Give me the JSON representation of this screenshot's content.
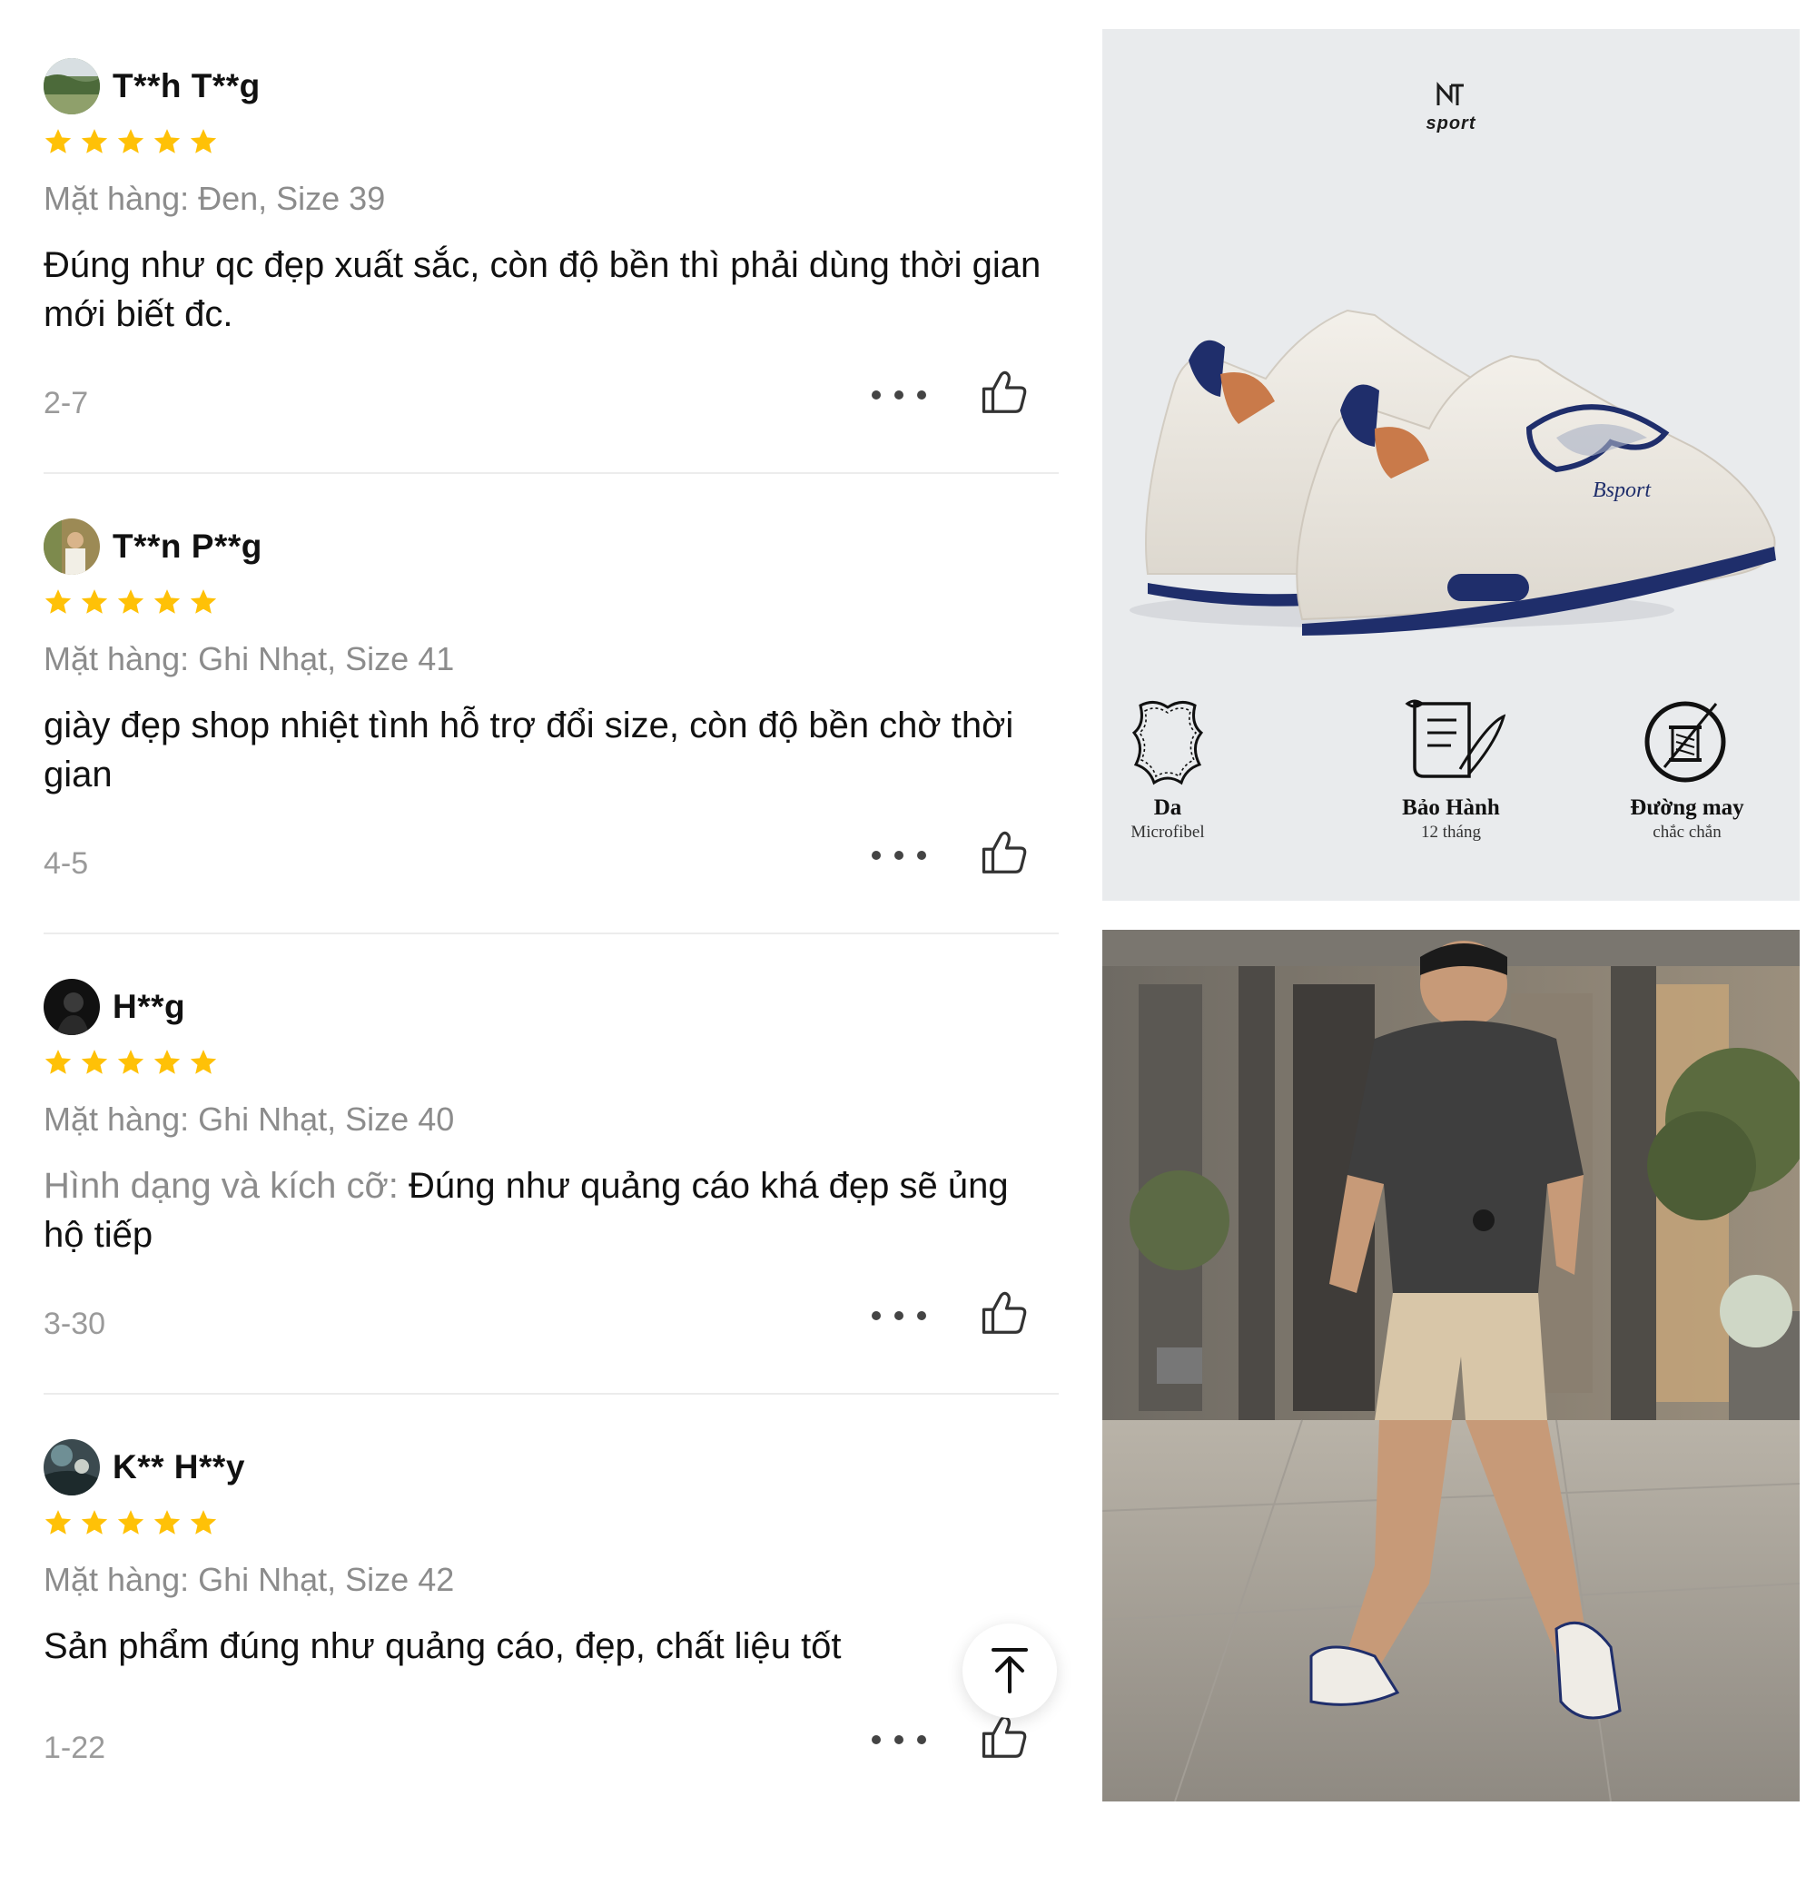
{
  "reviews": [
    {
      "user": "T**h T**g",
      "rating": 5,
      "variant": "Mặt hàng: Đen, Size 39",
      "comment_prefix": "",
      "comment": "Đúng như qc đẹp xuất sắc, còn độ bền thì phải dùng thời gian mới biết đc.",
      "date": "2-7"
    },
    {
      "user": "T**n P**g",
      "rating": 5,
      "variant": "Mặt hàng: Ghi Nhạt, Size 41",
      "comment_prefix": "",
      "comment": "giày đẹp shop nhiệt tình hỗ trợ đổi size, còn độ bền chờ thời gian",
      "date": "4-5"
    },
    {
      "user": "H**g",
      "rating": 5,
      "variant": "Mặt hàng: Ghi Nhạt, Size 40",
      "comment_prefix": "Hình dạng và kích cỡ: ",
      "comment": "Đúng như quảng cáo khá đẹp sẽ ủng hộ tiếp",
      "date": "3-30"
    },
    {
      "user": "K** H**y",
      "rating": 5,
      "variant": "Mặt hàng: Ghi Nhạt, Size 42",
      "comment_prefix": "",
      "comment": "Sản phẩm đúng như quảng cáo, đẹp, chất liệu tốt",
      "date": "1-22"
    }
  ],
  "product_panel": {
    "brand": "sport",
    "shoe_script": "Bsport",
    "features": [
      {
        "title": "Da",
        "subtitle": "Microfibel",
        "icon": "leather-hide-icon"
      },
      {
        "title": "Bảo Hành",
        "subtitle": "12 tháng",
        "icon": "warranty-scroll-icon"
      },
      {
        "title": "Đường may",
        "subtitle": "chắc chắn",
        "icon": "needle-thread-icon"
      }
    ]
  },
  "icons": {
    "star": "star-icon",
    "more": "more-dots-icon",
    "like": "thumbs-up-icon",
    "back_to_top": "arrow-up-icon"
  },
  "colors": {
    "star": "#FFC107",
    "text_muted": "#8C8C8C",
    "divider": "#ECECEC",
    "shoe_accent": "#1F2E6B"
  }
}
